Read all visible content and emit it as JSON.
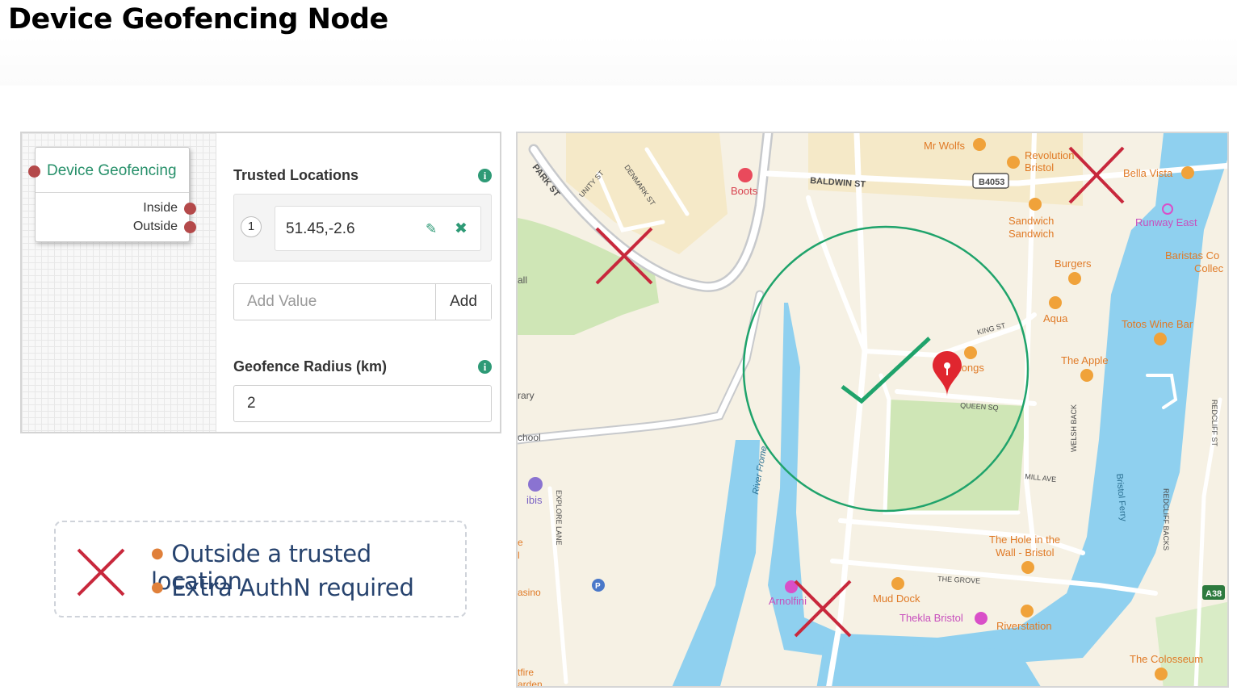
{
  "page": {
    "title": "Device Geofencing Node"
  },
  "node": {
    "title": "Device Geofencing",
    "outputs": [
      "Inside",
      "Outside"
    ]
  },
  "trusted_locations": {
    "label": "Trusted Locations",
    "items": [
      {
        "index": "1",
        "value": "51.45,-2.6"
      }
    ],
    "add_placeholder": "Add Value",
    "add_button": "Add"
  },
  "geofence_radius": {
    "label": "Geofence Radius (km)",
    "value": "2"
  },
  "legend": {
    "items": [
      "Outside a trusted location",
      "Extra AuthN required"
    ],
    "icon": "red-x-icon"
  },
  "colors": {
    "node_title": "#27906a",
    "port": "#b4494a",
    "deny_mark": "#c8283c",
    "allow_mark": "#1fa36b",
    "legend_text": "#27436e",
    "water": "#8fd0ef",
    "park": "#cfe6b6",
    "poi": "#f0a23a"
  },
  "map": {
    "streets": [
      "PARK ST",
      "UNITY ST",
      "DENMARK ST",
      "BALDWIN ST",
      "B4053",
      "KING ST",
      "QUEEN SQ",
      "WELSH BACK",
      "MILL AVE",
      "THE GROVE",
      "EXPLORE LANE",
      "REDCLIFF BACKS",
      "REDCLIFF ST",
      "A38",
      "River Frome",
      "Bristol Ferry"
    ],
    "pois": [
      {
        "name": "Mr Wolfs"
      },
      {
        "name": "Revolution Bristol",
        "lines": [
          "Revolution",
          "Bristol"
        ]
      },
      {
        "name": "Boots"
      },
      {
        "name": "Bella Vista"
      },
      {
        "name": "Runway East"
      },
      {
        "name": "Sandwich Sandwich",
        "lines": [
          "Sandwich",
          "Sandwich"
        ]
      },
      {
        "name": "Baristas Coffee Collective",
        "lines": [
          "Baristas Co",
          "Collec"
        ]
      },
      {
        "name": "Burgers"
      },
      {
        "name": "Aqua"
      },
      {
        "name": "Totos Wine Bar"
      },
      {
        "name": "Kongs"
      },
      {
        "name": "The Apple"
      },
      {
        "name": "The Hole in the Wall - Bristol",
        "lines": [
          "The Hole in the",
          "Wall - Bristol"
        ]
      },
      {
        "name": "Mud Dock"
      },
      {
        "name": "Thekla Bristol"
      },
      {
        "name": "Riverstation"
      },
      {
        "name": "Arnolfini"
      },
      {
        "name": "The Colosseum"
      },
      {
        "name": "ibis"
      }
    ],
    "edge_fragments": [
      "all",
      "rary",
      "chool",
      "e",
      "l",
      "asino",
      "tfire",
      "arden"
    ]
  }
}
